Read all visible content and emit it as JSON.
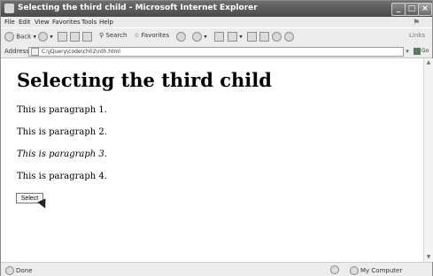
{
  "window": {
    "title": "Selecting the third child - Microsoft Internet Explorer"
  },
  "menu": [
    "File",
    "Edit",
    "View",
    "Favorites",
    "Tools",
    "Help"
  ],
  "toolbar": {
    "back_label": "Back",
    "search_label": "Search",
    "favorites_label": "Favorites",
    "links_label": "Links"
  },
  "address": {
    "label": "Address",
    "value": "C:\\jQuery\\code\\ch02\\nth.html",
    "go_label": "Go"
  },
  "page": {
    "heading": "Selecting the third child",
    "paragraphs": [
      "This is paragraph 1.",
      "This is paragraph 2.",
      "This is paragraph 3.",
      "This is paragraph 4."
    ],
    "button_label": "Select"
  },
  "status": {
    "left": "Done",
    "right": "My Computer"
  }
}
